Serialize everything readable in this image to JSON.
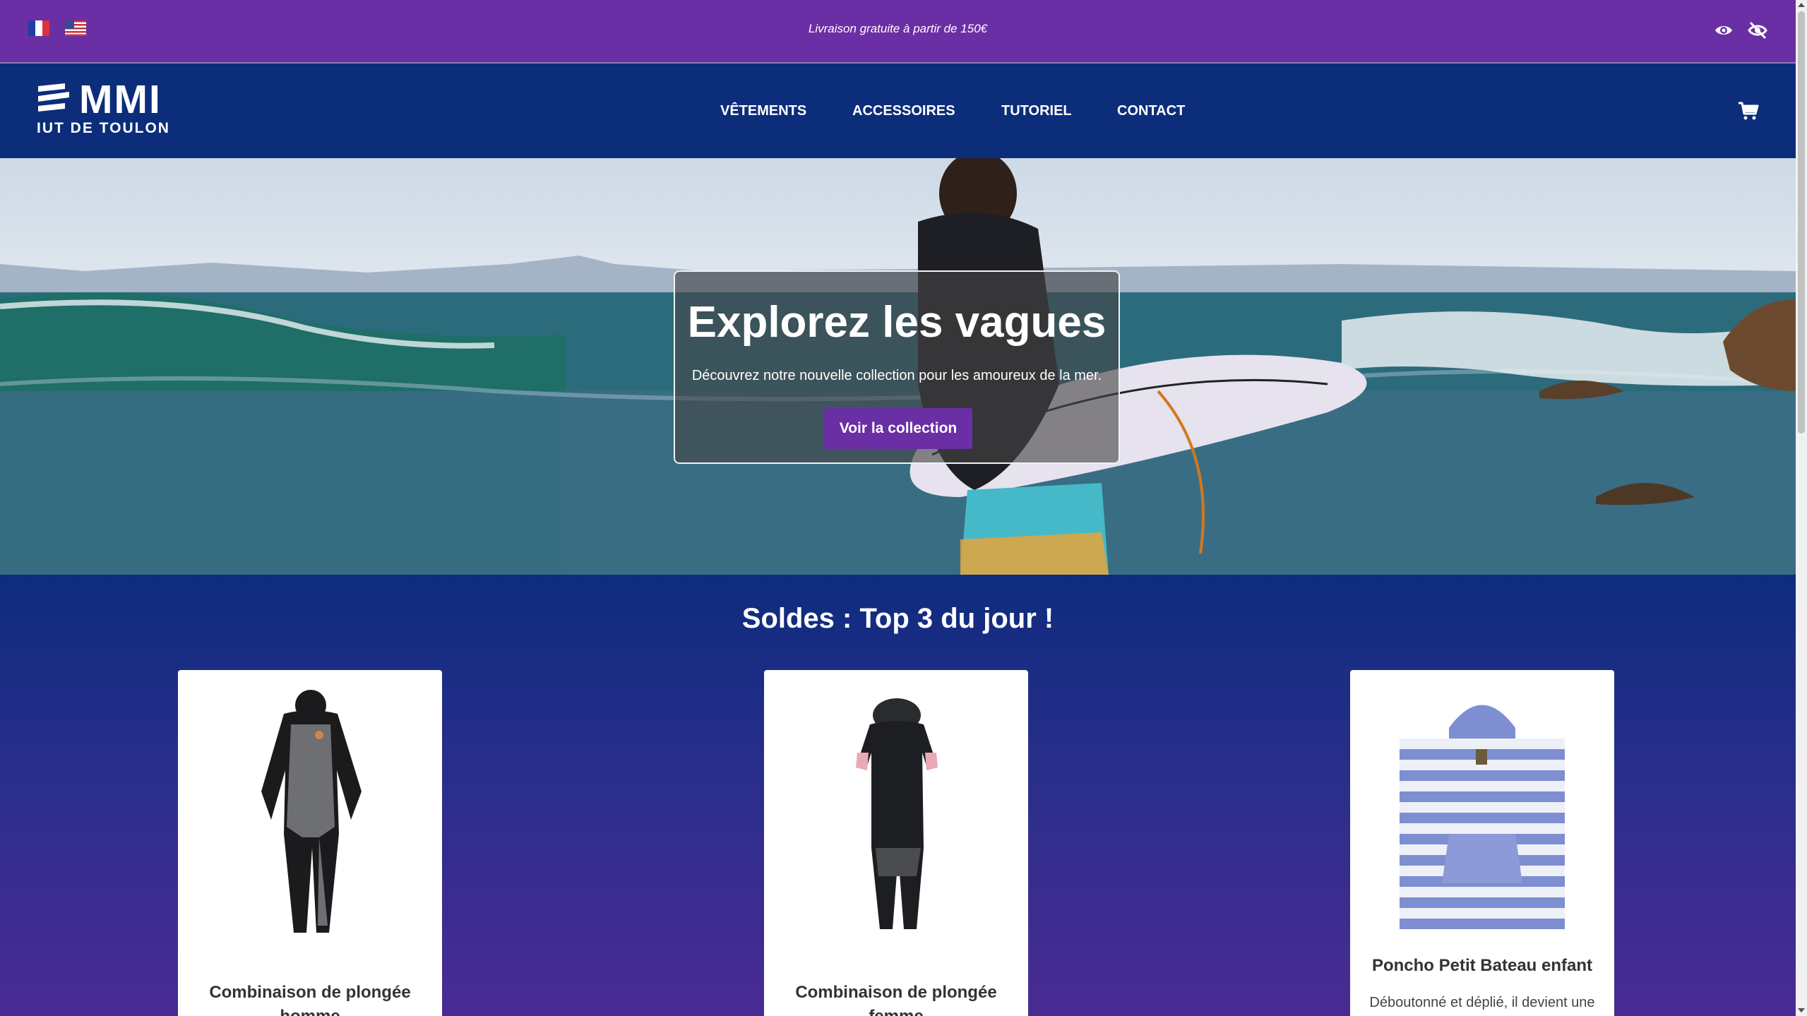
{
  "topbar": {
    "promo": "Livraison gratuite à partir de 150€",
    "languages": [
      {
        "code": "fr",
        "icon": "flag-france-icon"
      },
      {
        "code": "en",
        "icon": "flag-usa-icon"
      }
    ],
    "accessibility": [
      {
        "icon": "eye-icon"
      },
      {
        "icon": "eye-slash-icon"
      }
    ],
    "color": "#6a2fa4"
  },
  "header": {
    "logo_main": "MMI",
    "logo_sub": "IUT DE TOULON",
    "nav": [
      "VÊTEMENTS",
      "ACCESSOIRES",
      "TUTORIEL",
      "CONTACT"
    ],
    "cart_icon": "cart-icon",
    "color": "#0c2d7a"
  },
  "hero": {
    "title": "Explorez les vagues",
    "subtitle": "Découvrez notre nouvelle collection pour les amoureux de la mer.",
    "button": "Voir la collection"
  },
  "sales": {
    "title": "Soldes : Top 3 du jour !",
    "products": [
      {
        "name": "Combinaison de plongée homme",
        "image": "men-wetsuit-image"
      },
      {
        "name": "Combinaison de plongée femme",
        "image": "women-wetsuit-image"
      },
      {
        "name": "Poncho Petit Bateau enfant",
        "description": "Déboutonné et déplié, il devient une",
        "image": "kids-poncho-image"
      }
    ]
  }
}
